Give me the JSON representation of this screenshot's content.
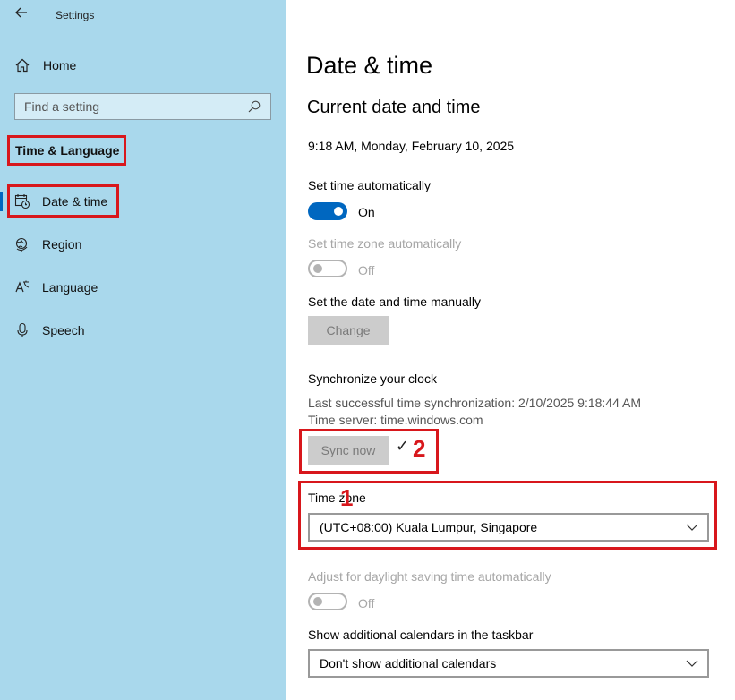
{
  "window": {
    "app_title": "Settings"
  },
  "sidebar": {
    "home_label": "Home",
    "search_placeholder": "Find a setting",
    "section_title": "Time & Language",
    "items": [
      {
        "label": "Date & time",
        "icon": "calendar-clock-icon"
      },
      {
        "label": "Region",
        "icon": "globe-icon"
      },
      {
        "label": "Language",
        "icon": "language-icon"
      },
      {
        "label": "Speech",
        "icon": "microphone-icon"
      }
    ]
  },
  "main": {
    "page_title": "Date & time",
    "sub_title": "Current date and time",
    "current_datetime": "9:18 AM, Monday, February 10, 2025",
    "set_time_auto": {
      "label": "Set time automatically",
      "state": "On"
    },
    "set_zone_auto": {
      "label": "Set time zone automatically",
      "state": "Off"
    },
    "manual": {
      "label": "Set the date and time manually",
      "button": "Change"
    },
    "sync": {
      "label": "Synchronize your clock",
      "last_sync": "Last successful time synchronization: 2/10/2025 9:18:44 AM",
      "server": "Time server: time.windows.com",
      "button": "Sync now",
      "annotation": "2"
    },
    "time_zone": {
      "label": "Time zone",
      "annotation": "1",
      "value": "(UTC+08:00) Kuala Lumpur, Singapore"
    },
    "dst": {
      "label": "Adjust for daylight saving time automatically",
      "state": "Off"
    },
    "calendars": {
      "label": "Show additional calendars in the taskbar",
      "value": "Don't show additional calendars"
    }
  },
  "colors": {
    "sidebar_bg": "#a9d8ec",
    "accent": "#0067c0",
    "highlight": "#d8171c"
  }
}
